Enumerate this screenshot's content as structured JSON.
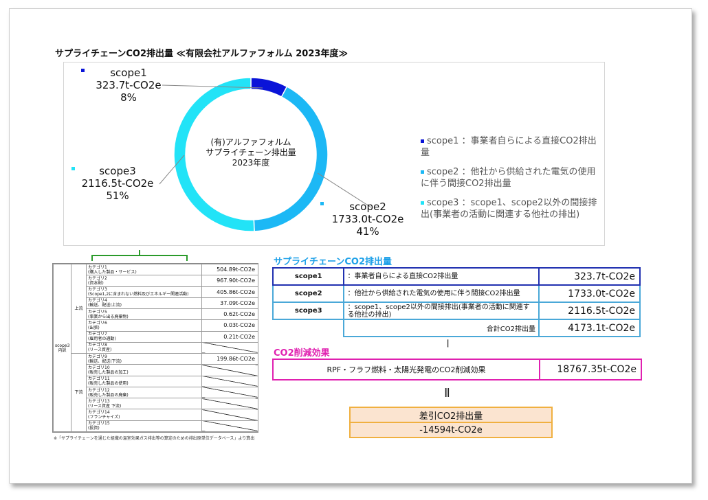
{
  "title": "サプライチェーンCO2排出量 ≪有限会社アルファフォルム 2023年度≫",
  "chart_data": {
    "type": "pie",
    "center_text": [
      "(有)アルファフォルム",
      "サプライチェーン排出量",
      "2023年度"
    ],
    "categories": [
      "scope1",
      "scope2",
      "scope3"
    ],
    "values": [
      323.7,
      1733.0,
      2116.5
    ],
    "value_labels": [
      "323.7t-CO2e",
      "1733.0t-CO2e",
      "2116.5t-CO2e"
    ],
    "percent_labels": [
      "8%",
      "41%",
      "51%"
    ],
    "colors": [
      "#0a14d8",
      "#1cb8f5",
      "#22e3f7"
    ],
    "legend": [
      "scope1 ：事業者自らによる直接CO2排出量",
      "scope2 ：他社から供給された電気の使用に伴う間接CO2排出量",
      "scope3 ：scope1、scope2以外の間接排出(事業者の活動に関連する他社の排出)"
    ]
  },
  "category_table": {
    "group_label": "scope3 内訳",
    "upstream_label": "上流",
    "downstream_label": "下流",
    "rows": [
      {
        "name": "カテゴリ1",
        "sub": "(購入した製品・サービス)",
        "value": "504.89t-CO2e"
      },
      {
        "name": "カテゴリ2",
        "sub": "(資本財)",
        "value": "967.90t-CO2e"
      },
      {
        "name": "カテゴリ3",
        "sub": "(Scope1,2に含まれない燃料及びエネルギー関連活動)",
        "value": "405.86t-CO2e"
      },
      {
        "name": "カテゴリ4",
        "sub": "(輸送、配送(上流)",
        "value": "37.09t-CO2e"
      },
      {
        "name": "カテゴリ5",
        "sub": "(事業から出る廃棄物)",
        "value": "0.62t-CO2e"
      },
      {
        "name": "カテゴリ6",
        "sub": "(出張)",
        "value": "0.03t-CO2e"
      },
      {
        "name": "カテゴリ7",
        "sub": "(雇用者の通勤)",
        "value": "0.21t-CO2e"
      },
      {
        "name": "カテゴリ8",
        "sub": "(リース資産)",
        "value": ""
      },
      {
        "name": "カテゴリ9",
        "sub": "(輸送、配送(下流)",
        "value": "199.86t-CO2e"
      },
      {
        "name": "カテゴリ10",
        "sub": "(販売した製品の加工)",
        "value": ""
      },
      {
        "name": "カテゴリ11",
        "sub": "(販売した製品の使用)",
        "value": ""
      },
      {
        "name": "カテゴリ12",
        "sub": "(販売した製品の廃棄)",
        "value": ""
      },
      {
        "name": "カテゴリ13",
        "sub": "(リース資産 下流)",
        "value": ""
      },
      {
        "name": "カテゴリ14",
        "sub": "(フランチャイズ)",
        "value": ""
      },
      {
        "name": "カテゴリ15",
        "sub": "(投資)",
        "value": ""
      }
    ],
    "note": "※「サプライチェーンを通じた組織の温室効果ガス排出等の算定のための排出原単位データベース」より算出"
  },
  "supply": {
    "heading": "サプライチェーンCO2排出量",
    "rows": [
      {
        "name": "scope1",
        "desc": "：事業者自らによる直接CO2排出量",
        "amount": "323.7t-CO2e"
      },
      {
        "name": "scope2",
        "desc": "：他社から供給された電気の使用に伴う間接CO2排出量",
        "amount": "1733.0t-CO2e"
      },
      {
        "name": "scope3",
        "desc": "：scope1、scope2以外の間接排出(事業者の活動に関連する他社の排出)",
        "amount": "2116.5t-CO2e"
      }
    ],
    "total_label": "合計CO2排出量",
    "total_amount": "4173.1t-CO2e"
  },
  "minus_sign": "ー",
  "equals_sign": "Ⅱ",
  "reduction": {
    "heading": "CO2削減効果",
    "desc": "RPF・フラフ燃料・太陽光発電のCO2削減効果",
    "amount": "18767.35t-CO2e"
  },
  "net": {
    "label": "差引CO2排出量",
    "value": "-14594t-CO2e"
  }
}
